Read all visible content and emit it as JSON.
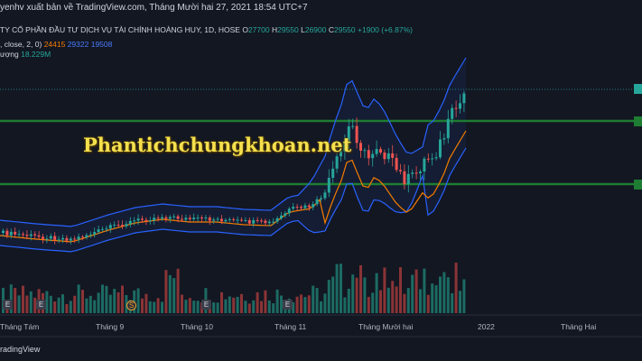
{
  "header": {
    "publisher_text": "yenhv xuất bản về TradingView.com, Tháng Mười hai 27, 2021 18:54 UTC+7"
  },
  "legend": {
    "symbol_text": "TY CỔ PHẦN ĐẦU TƯ DỊCH VỤ TÀI CHÍNH HOÀNG HUY, 1D, HOSE",
    "open_label": "O",
    "open_value": "27700",
    "high_label": "H",
    "high_value": "29550",
    "low_label": "L",
    "low_value": "26900",
    "close_label": "C",
    "close_value": "29550",
    "change_text": "+1900 (+6.87%)",
    "bb_params": ", close, 2, 0)",
    "bb_basis": "24415",
    "bb_upper": "29322",
    "bb_lower": "19508",
    "volume_label": "ượng",
    "volume_value": "18.229M"
  },
  "watermark_text": "Phantichchungkhoan.net",
  "x_axis": {
    "ticks": [
      "Tháng Tám",
      "Tháng 9",
      "Tháng 10",
      "Tháng 11",
      "Tháng Mười hai",
      "2022",
      "Tháng Hai"
    ]
  },
  "events": {
    "earnings_label": "E",
    "dividend_label": "S"
  },
  "footer_text": "radingView",
  "colors": {
    "background": "#131722",
    "up": "#26a69a",
    "down": "#ef5350",
    "bb_basis": "#f57c00",
    "bb_band": "#2962ff",
    "support_line": "#1e7d32",
    "watermark": "#f4e04d"
  }
}
